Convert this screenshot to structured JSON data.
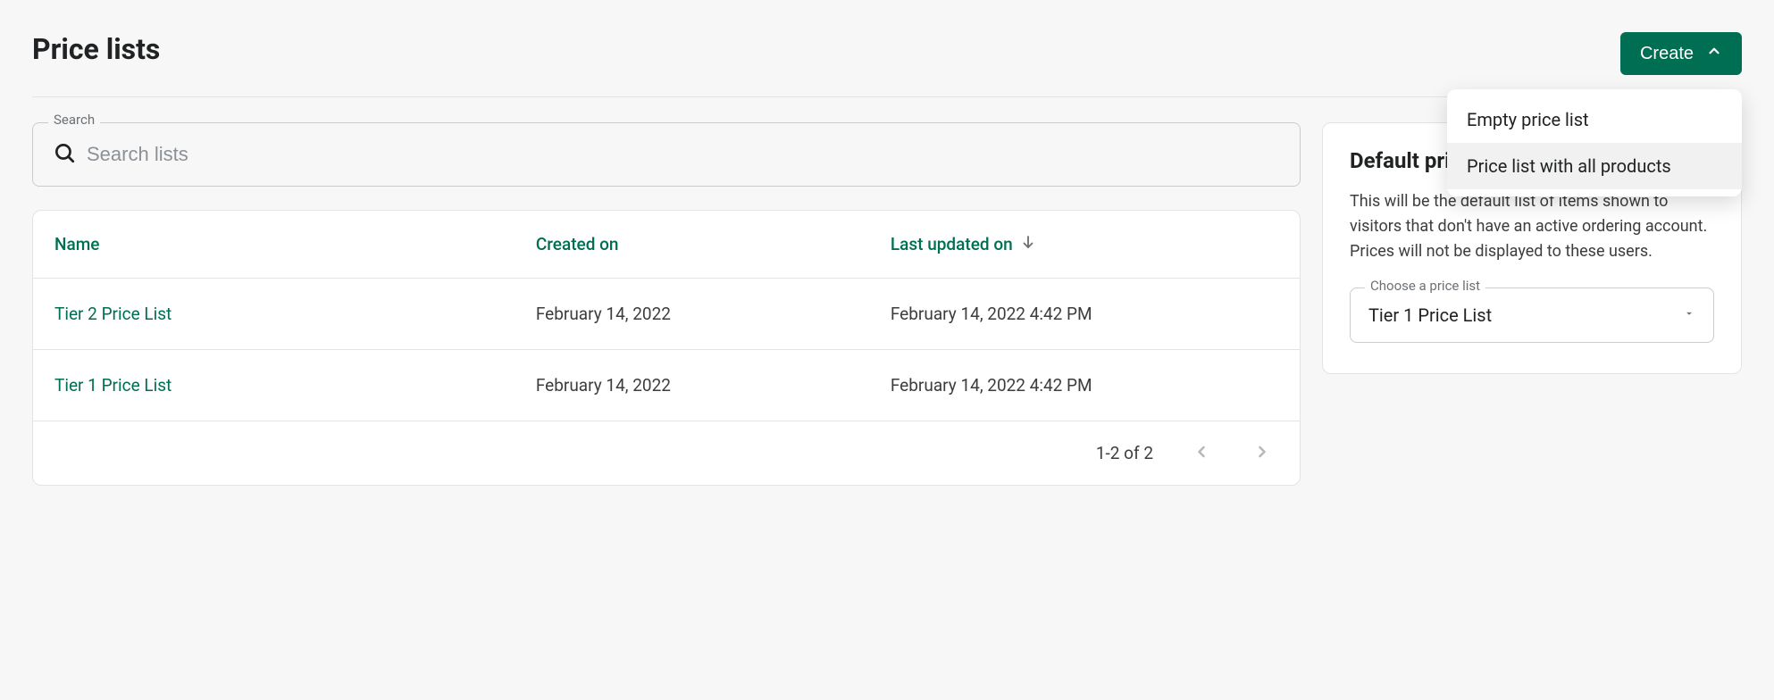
{
  "header": {
    "title": "Price lists",
    "create_label": "Create",
    "dropdown": {
      "item_empty": "Empty price list",
      "item_all": "Price list with all products"
    }
  },
  "search": {
    "legend": "Search",
    "placeholder": "Search lists"
  },
  "table": {
    "columns": {
      "name": "Name",
      "created": "Created on",
      "updated": "Last updated on"
    },
    "rows": [
      {
        "name": "Tier 2 Price List",
        "created": "February 14, 2022",
        "updated": "February 14, 2022 4:42 PM"
      },
      {
        "name": "Tier 1 Price List",
        "created": "February 14, 2022",
        "updated": "February 14, 2022 4:42 PM"
      }
    ],
    "pagination": "1-2 of 2"
  },
  "side": {
    "title": "Default price list",
    "description": "This will be the default list of items shown to visitors that don't have an active ordering account. Prices will not be displayed to these users.",
    "select_legend": "Choose a price list",
    "select_value": "Tier 1 Price List"
  }
}
